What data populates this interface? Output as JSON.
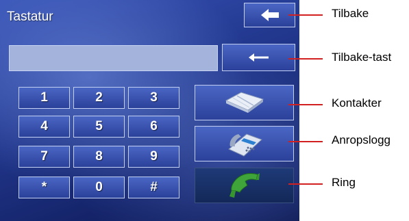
{
  "window": {
    "title": "Tastatur"
  },
  "display": {
    "value": ""
  },
  "keypad": {
    "keys": [
      "1",
      "2",
      "3",
      "4",
      "5",
      "6",
      "7",
      "8",
      "9",
      "*",
      "0",
      "#"
    ]
  },
  "buttons": {
    "back": {
      "icon": "arrow-left-filled-icon"
    },
    "backspace": {
      "icon": "arrow-left-thin-icon"
    },
    "contacts": {
      "icon": "address-book-icon"
    },
    "call_log": {
      "icon": "telephone-icon"
    },
    "ring": {
      "icon": "phone-handset-icon"
    }
  },
  "callouts": {
    "back": "Tilbake",
    "backspace": "Tilbake-tast",
    "contacts": "Kontakter",
    "call_log": "Anropslogg",
    "ring": "Ring"
  },
  "colors": {
    "leader_line": "#d21f1f",
    "handset": "#3fa43a"
  }
}
